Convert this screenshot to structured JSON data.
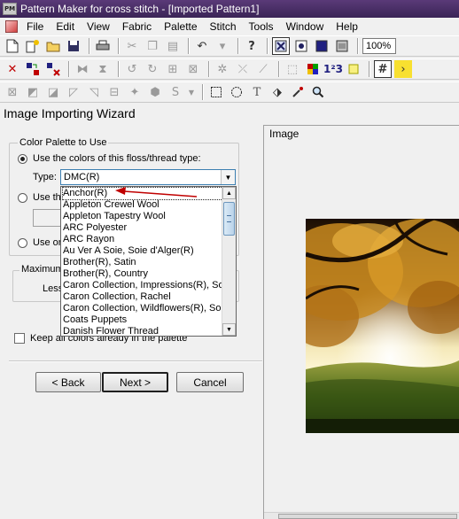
{
  "window": {
    "title": "Pattern Maker for cross stitch - [Imported Pattern1]",
    "app_icon_text": "PM"
  },
  "menubar": {
    "items": [
      "File",
      "Edit",
      "View",
      "Fabric",
      "Palette",
      "Stitch",
      "Tools",
      "Window",
      "Help"
    ]
  },
  "toolbar": {
    "zoom_value": "100%"
  },
  "wizard": {
    "title": "Image Importing Wizard",
    "palette_group": {
      "label": "Color Palette to Use",
      "option_floss": "Use the colors of this floss/thread type:",
      "type_label": "Type:",
      "type_value": "DMC(R)",
      "option_this": "Use th",
      "option_only": "Use or"
    },
    "max_group": {
      "label": "Maximum",
      "less_label": "Less"
    },
    "keep_colors_label": "Keep all colors already in the palette",
    "dropdown_items": [
      "Anchor(R)",
      "Appleton Crewel Wool",
      "Appleton Tapestry Wool",
      "ARC Polyester",
      "ARC Rayon",
      "Au Ver A Soie, Soie d'Alger(R)",
      "Brother(R), Satin",
      "Brother(R), Country",
      "Caron Collection, Impressions(R), Solid",
      "Caron Collection, Rachel",
      "Caron Collection, Wildflowers(R), Solid",
      "Coats Puppets",
      "Danish Flower Thread"
    ],
    "buttons": {
      "back": "< Back",
      "next": "Next >",
      "cancel": "Cancel"
    },
    "image_panel_label": "Image"
  },
  "colors": {
    "titlebar": "#4a2e66",
    "annotation_arrow": "#c00000",
    "scroll_thumb": "#b9d3ea"
  }
}
